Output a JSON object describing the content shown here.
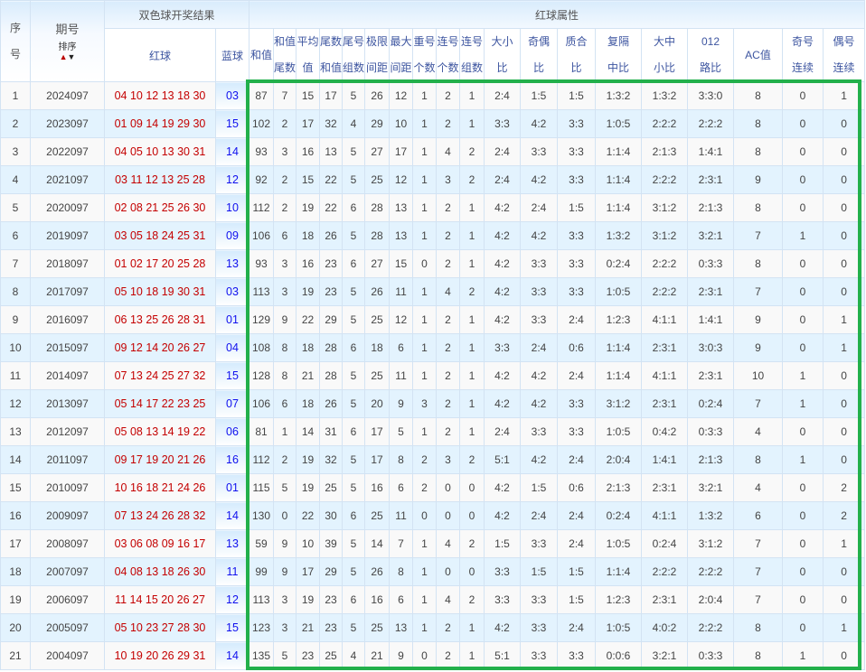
{
  "header": {
    "no": [
      "序",
      "号"
    ],
    "issue": "期号",
    "sort_label": "排序",
    "sort_up": "▲",
    "sort_down": "▼",
    "draw_group": "双色球开奖结果",
    "attr_group": "红球属性",
    "red": "红球",
    "blue": "蓝球",
    "attrs": [
      [
        "和值"
      ],
      [
        "和值",
        "尾数"
      ],
      [
        "平均",
        "值"
      ],
      [
        "尾数",
        "和值"
      ],
      [
        "尾号",
        "组数"
      ],
      [
        "极限",
        "间距"
      ],
      [
        "最大",
        "间距"
      ],
      [
        "重号",
        "个数"
      ],
      [
        "连号",
        "个数"
      ],
      [
        "连号",
        "组数"
      ],
      [
        "大小",
        "比"
      ],
      [
        "奇偶",
        "比"
      ],
      [
        "质合",
        "比"
      ],
      [
        "复隔",
        "中比"
      ],
      [
        "大中",
        "小比"
      ],
      [
        "012",
        "路比"
      ],
      [
        "AC值"
      ],
      [
        "奇号",
        "连续"
      ],
      [
        "偶号",
        "连续"
      ]
    ]
  },
  "rows": [
    {
      "no": "1",
      "issue": "2024097",
      "red": "04 10 12 13 18 30",
      "blue": "03",
      "attrs": [
        "87",
        "7",
        "15",
        "17",
        "5",
        "26",
        "12",
        "1",
        "2",
        "1",
        "2:4",
        "1:5",
        "1:5",
        "1:3:2",
        "1:3:2",
        "3:3:0",
        "8",
        "0",
        "1"
      ]
    },
    {
      "no": "2",
      "issue": "2023097",
      "red": "01 09 14 19 29 30",
      "blue": "15",
      "attrs": [
        "102",
        "2",
        "17",
        "32",
        "4",
        "29",
        "10",
        "1",
        "2",
        "1",
        "3:3",
        "4:2",
        "3:3",
        "1:0:5",
        "2:2:2",
        "2:2:2",
        "8",
        "0",
        "0"
      ]
    },
    {
      "no": "3",
      "issue": "2022097",
      "red": "04 05 10 13 30 31",
      "blue": "14",
      "attrs": [
        "93",
        "3",
        "16",
        "13",
        "5",
        "27",
        "17",
        "1",
        "4",
        "2",
        "2:4",
        "3:3",
        "3:3",
        "1:1:4",
        "2:1:3",
        "1:4:1",
        "8",
        "0",
        "0"
      ]
    },
    {
      "no": "4",
      "issue": "2021097",
      "red": "03 11 12 13 25 28",
      "blue": "12",
      "attrs": [
        "92",
        "2",
        "15",
        "22",
        "5",
        "25",
        "12",
        "1",
        "3",
        "2",
        "2:4",
        "4:2",
        "3:3",
        "1:1:4",
        "2:2:2",
        "2:3:1",
        "9",
        "0",
        "0"
      ]
    },
    {
      "no": "5",
      "issue": "2020097",
      "red": "02 08 21 25 26 30",
      "blue": "10",
      "attrs": [
        "112",
        "2",
        "19",
        "22",
        "6",
        "28",
        "13",
        "1",
        "2",
        "1",
        "4:2",
        "2:4",
        "1:5",
        "1:1:4",
        "3:1:2",
        "2:1:3",
        "8",
        "0",
        "0"
      ]
    },
    {
      "no": "6",
      "issue": "2019097",
      "red": "03 05 18 24 25 31",
      "blue": "09",
      "attrs": [
        "106",
        "6",
        "18",
        "26",
        "5",
        "28",
        "13",
        "1",
        "2",
        "1",
        "4:2",
        "4:2",
        "3:3",
        "1:3:2",
        "3:1:2",
        "3:2:1",
        "7",
        "1",
        "0"
      ]
    },
    {
      "no": "7",
      "issue": "2018097",
      "red": "01 02 17 20 25 28",
      "blue": "13",
      "attrs": [
        "93",
        "3",
        "16",
        "23",
        "6",
        "27",
        "15",
        "0",
        "2",
        "1",
        "4:2",
        "3:3",
        "3:3",
        "0:2:4",
        "2:2:2",
        "0:3:3",
        "8",
        "0",
        "0"
      ]
    },
    {
      "no": "8",
      "issue": "2017097",
      "red": "05 10 18 19 30 31",
      "blue": "03",
      "attrs": [
        "113",
        "3",
        "19",
        "23",
        "5",
        "26",
        "11",
        "1",
        "4",
        "2",
        "4:2",
        "3:3",
        "3:3",
        "1:0:5",
        "2:2:2",
        "2:3:1",
        "7",
        "0",
        "0"
      ]
    },
    {
      "no": "9",
      "issue": "2016097",
      "red": "06 13 25 26 28 31",
      "blue": "01",
      "attrs": [
        "129",
        "9",
        "22",
        "29",
        "5",
        "25",
        "12",
        "1",
        "2",
        "1",
        "4:2",
        "3:3",
        "2:4",
        "1:2:3",
        "4:1:1",
        "1:4:1",
        "9",
        "0",
        "1"
      ]
    },
    {
      "no": "10",
      "issue": "2015097",
      "red": "09 12 14 20 26 27",
      "blue": "04",
      "attrs": [
        "108",
        "8",
        "18",
        "28",
        "6",
        "18",
        "6",
        "1",
        "2",
        "1",
        "3:3",
        "2:4",
        "0:6",
        "1:1:4",
        "2:3:1",
        "3:0:3",
        "9",
        "0",
        "1"
      ]
    },
    {
      "no": "11",
      "issue": "2014097",
      "red": "07 13 24 25 27 32",
      "blue": "15",
      "attrs": [
        "128",
        "8",
        "21",
        "28",
        "5",
        "25",
        "11",
        "1",
        "2",
        "1",
        "4:2",
        "4:2",
        "2:4",
        "1:1:4",
        "4:1:1",
        "2:3:1",
        "10",
        "1",
        "0"
      ]
    },
    {
      "no": "12",
      "issue": "2013097",
      "red": "05 14 17 22 23 25",
      "blue": "07",
      "attrs": [
        "106",
        "6",
        "18",
        "26",
        "5",
        "20",
        "9",
        "3",
        "2",
        "1",
        "4:2",
        "4:2",
        "3:3",
        "3:1:2",
        "2:3:1",
        "0:2:4",
        "7",
        "1",
        "0"
      ]
    },
    {
      "no": "13",
      "issue": "2012097",
      "red": "05 08 13 14 19 22",
      "blue": "06",
      "attrs": [
        "81",
        "1",
        "14",
        "31",
        "6",
        "17",
        "5",
        "1",
        "2",
        "1",
        "2:4",
        "3:3",
        "3:3",
        "1:0:5",
        "0:4:2",
        "0:3:3",
        "4",
        "0",
        "0"
      ]
    },
    {
      "no": "14",
      "issue": "2011097",
      "red": "09 17 19 20 21 26",
      "blue": "16",
      "attrs": [
        "112",
        "2",
        "19",
        "32",
        "5",
        "17",
        "8",
        "2",
        "3",
        "2",
        "5:1",
        "4:2",
        "2:4",
        "2:0:4",
        "1:4:1",
        "2:1:3",
        "8",
        "1",
        "0"
      ]
    },
    {
      "no": "15",
      "issue": "2010097",
      "red": "10 16 18 21 24 26",
      "blue": "01",
      "attrs": [
        "115",
        "5",
        "19",
        "25",
        "5",
        "16",
        "6",
        "2",
        "0",
        "0",
        "4:2",
        "1:5",
        "0:6",
        "2:1:3",
        "2:3:1",
        "3:2:1",
        "4",
        "0",
        "2"
      ]
    },
    {
      "no": "16",
      "issue": "2009097",
      "red": "07 13 24 26 28 32",
      "blue": "14",
      "attrs": [
        "130",
        "0",
        "22",
        "30",
        "6",
        "25",
        "11",
        "0",
        "0",
        "0",
        "4:2",
        "2:4",
        "2:4",
        "0:2:4",
        "4:1:1",
        "1:3:2",
        "6",
        "0",
        "2"
      ]
    },
    {
      "no": "17",
      "issue": "2008097",
      "red": "03 06 08 09 16 17",
      "blue": "13",
      "attrs": [
        "59",
        "9",
        "10",
        "39",
        "5",
        "14",
        "7",
        "1",
        "4",
        "2",
        "1:5",
        "3:3",
        "2:4",
        "1:0:5",
        "0:2:4",
        "3:1:2",
        "7",
        "0",
        "1"
      ]
    },
    {
      "no": "18",
      "issue": "2007097",
      "red": "04 08 13 18 26 30",
      "blue": "11",
      "attrs": [
        "99",
        "9",
        "17",
        "29",
        "5",
        "26",
        "8",
        "1",
        "0",
        "0",
        "3:3",
        "1:5",
        "1:5",
        "1:1:4",
        "2:2:2",
        "2:2:2",
        "7",
        "0",
        "0"
      ]
    },
    {
      "no": "19",
      "issue": "2006097",
      "red": "11 14 15 20 26 27",
      "blue": "12",
      "attrs": [
        "113",
        "3",
        "19",
        "23",
        "6",
        "16",
        "6",
        "1",
        "4",
        "2",
        "3:3",
        "3:3",
        "1:5",
        "1:2:3",
        "2:3:1",
        "2:0:4",
        "7",
        "0",
        "0"
      ]
    },
    {
      "no": "20",
      "issue": "2005097",
      "red": "05 10 23 27 28 30",
      "blue": "15",
      "attrs": [
        "123",
        "3",
        "21",
        "23",
        "5",
        "25",
        "13",
        "1",
        "2",
        "1",
        "4:2",
        "3:3",
        "2:4",
        "1:0:5",
        "4:0:2",
        "2:2:2",
        "8",
        "0",
        "1"
      ]
    },
    {
      "no": "21",
      "issue": "2004097",
      "red": "10 19 20 26 29 31",
      "blue": "14",
      "attrs": [
        "135",
        "5",
        "23",
        "25",
        "4",
        "21",
        "9",
        "0",
        "2",
        "1",
        "5:1",
        "3:3",
        "3:3",
        "0:0:6",
        "3:2:1",
        "0:3:3",
        "8",
        "1",
        "0"
      ]
    }
  ],
  "colors": {
    "highlight_box": "#22b04b",
    "red_ball": "#c40000",
    "blue_ball": "#1010ee",
    "row_alt": "#e3f3fe"
  }
}
